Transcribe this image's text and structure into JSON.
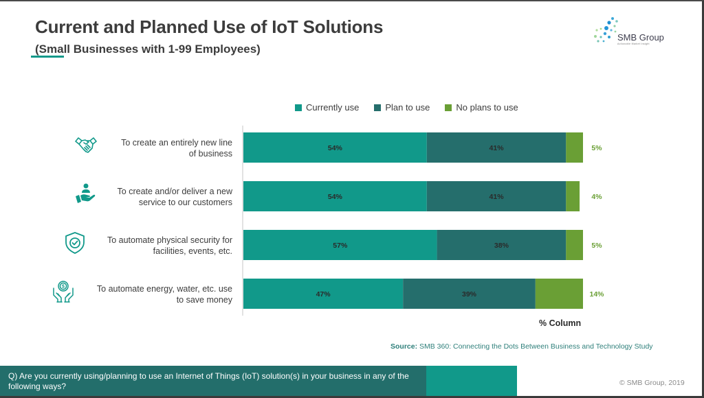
{
  "header": {
    "title": "Current and Planned Use of IoT Solutions",
    "subtitle": "(Small Businesses with 1-99 Employees)"
  },
  "logo": {
    "name": "SMB Group",
    "tagline": "Actionable Market Insight"
  },
  "colors": {
    "currently_use": "#11998a",
    "plan_to_use": "#256e6c",
    "no_plans": "#6a9f35",
    "accent": "#11998a"
  },
  "chart_data": {
    "type": "bar",
    "orientation": "horizontal",
    "stacked": true,
    "title": "Current and Planned Use of IoT Solutions",
    "subtitle": "(Small Businesses with 1-99 Employees)",
    "xlabel": "% Column",
    "ylabel": "",
    "xlim": [
      0,
      100
    ],
    "grid": false,
    "legend_position": "top",
    "categories": [
      "To create an entirely new line of business",
      "To create and/or deliver a new service to our customers",
      "To automate physical security for facilities, events, etc.",
      "To automate energy, water, etc. use to save money"
    ],
    "category_icons": [
      "handshake-icon",
      "hand-service-icon",
      "shield-check-icon",
      "hands-money-icon"
    ],
    "series": [
      {
        "name": "Currently use",
        "values": [
          54,
          54,
          57,
          47
        ],
        "labels": [
          "54%",
          "54%",
          "57%",
          "47%"
        ]
      },
      {
        "name": "Plan to use",
        "values": [
          41,
          41,
          38,
          39
        ],
        "labels": [
          "41%",
          "41%",
          "38%",
          "39%"
        ]
      },
      {
        "name": "No plans to use",
        "values": [
          5,
          4,
          5,
          14
        ],
        "labels": [
          "5%",
          "4%",
          "5%",
          "14%"
        ]
      }
    ]
  },
  "category_lines": [
    [
      "To create an entirely new line",
      "of business"
    ],
    [
      "To create and/or deliver a new",
      "service to our customers"
    ],
    [
      "To automate physical security for",
      "facilities, events, etc."
    ],
    [
      "To automate energy, water, etc. use",
      "to save money"
    ]
  ],
  "footer": {
    "source_label": "Source:",
    "source_text": " SMB 360: Connecting the Dots Between Business and Technology Study",
    "question": "Q) Are you currently using/planning to use an Internet of Things (IoT) solution(s) in your business in any of the following ways?",
    "copyright": "© SMB Group, 2019"
  }
}
